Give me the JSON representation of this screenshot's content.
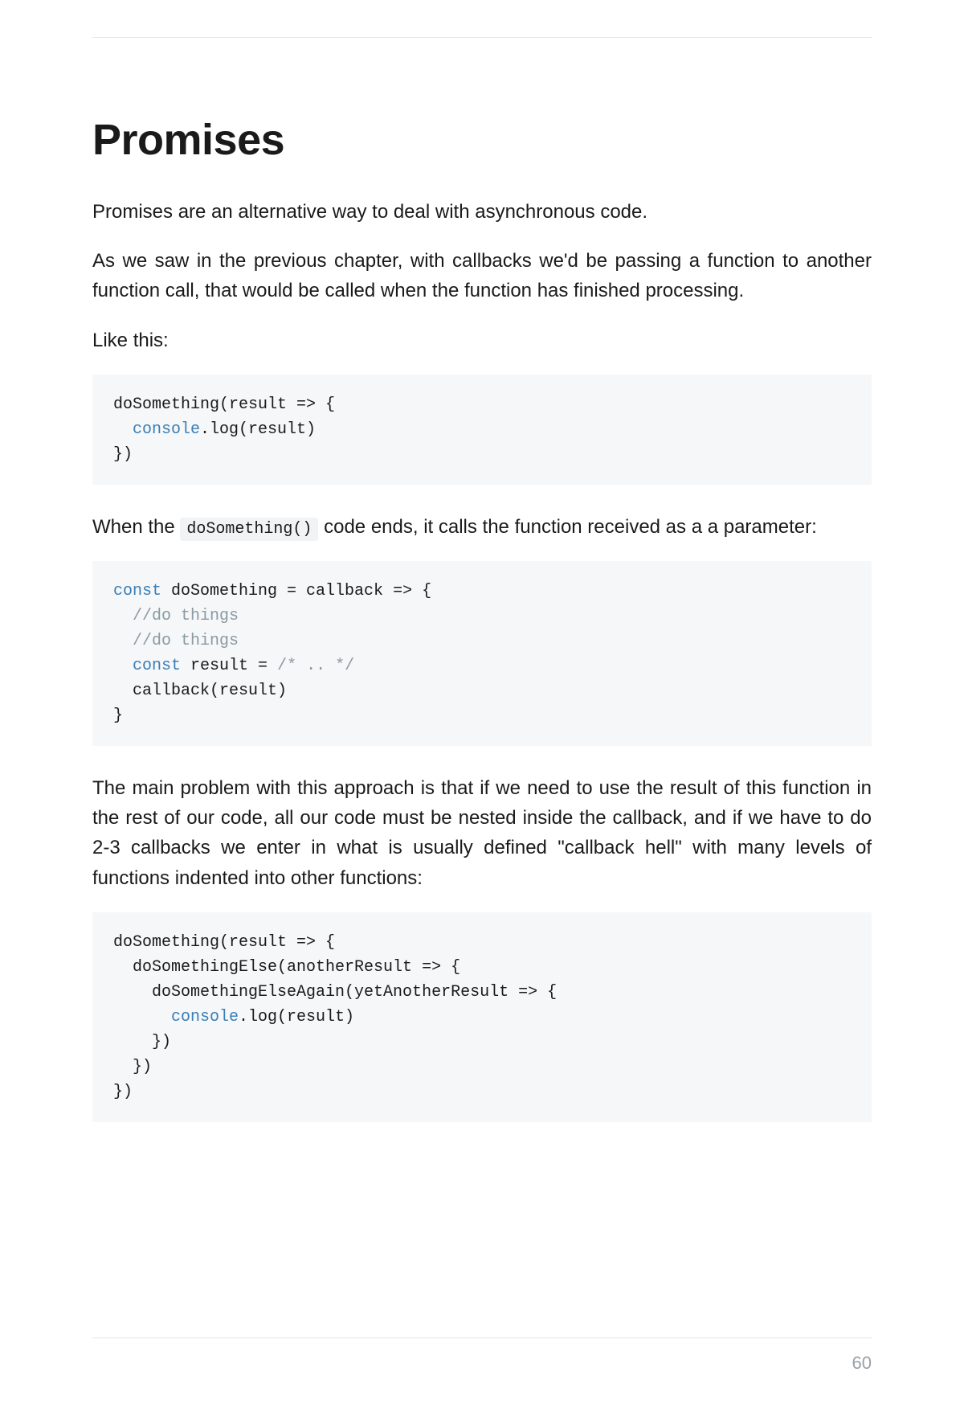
{
  "page": {
    "number": "60",
    "title": "Promises",
    "paragraphs": {
      "p1": "Promises are an alternative way to deal with asynchronous code.",
      "p2": "As we saw in the previous chapter, with callbacks we'd be passing a function to another function call, that would be called when the function has finished processing.",
      "p3": "Like this:",
      "p4_prefix": "When the ",
      "p4_code": "doSomething()",
      "p4_suffix": " code ends, it calls the function received as a a parameter:",
      "p5": "The main problem with this approach is that if we need to use the result of this function in the rest of our code, all our code must be nested inside the callback, and if we have to do 2-3 callbacks we enter in what is usually defined \"callback hell\" with many levels of functions indented into other functions:"
    },
    "code": {
      "block1": {
        "l1a": "doSomething(result => {",
        "l2_indent": "  ",
        "l2_builtin": "console",
        "l2_rest": ".log(result)",
        "l3": "})"
      },
      "block2": {
        "l1_kw": "const",
        "l1_rest": " doSomething = callback => {",
        "l2_indent": "  ",
        "l2_comment": "//do things",
        "l3_indent": "  ",
        "l3_comment": "//do things",
        "l4_indent": "  ",
        "l4_kw": "const",
        "l4_mid": " result = ",
        "l4_comment": "/* .. */",
        "l5": "  callback(result)",
        "l6": "}"
      },
      "block3": {
        "l1": "doSomething(result => {",
        "l2": "  doSomethingElse(anotherResult => {",
        "l3": "    doSomethingElseAgain(yetAnotherResult => {",
        "l4_indent": "      ",
        "l4_builtin": "console",
        "l4_rest": ".log(result)",
        "l5": "    })",
        "l6": "  })",
        "l7": "})"
      }
    }
  }
}
